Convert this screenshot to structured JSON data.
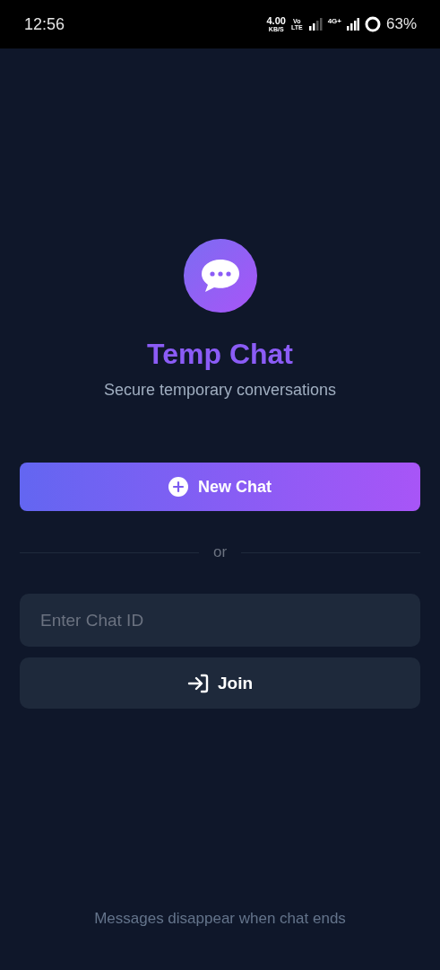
{
  "status_bar": {
    "time": "12:56",
    "data_speed": "4.00",
    "data_unit": "KB/S",
    "volte_top": "Vo",
    "volte_bottom": "LTE",
    "network": "4G+",
    "battery": "63%"
  },
  "app": {
    "title": "Temp Chat",
    "subtitle": "Secure temporary conversations"
  },
  "new_chat_button": {
    "label": "New Chat"
  },
  "divider": {
    "label": "or"
  },
  "chat_id_field": {
    "placeholder": "Enter Chat ID"
  },
  "join_button": {
    "label": "Join"
  },
  "footer": {
    "text": "Messages disappear when chat ends"
  }
}
